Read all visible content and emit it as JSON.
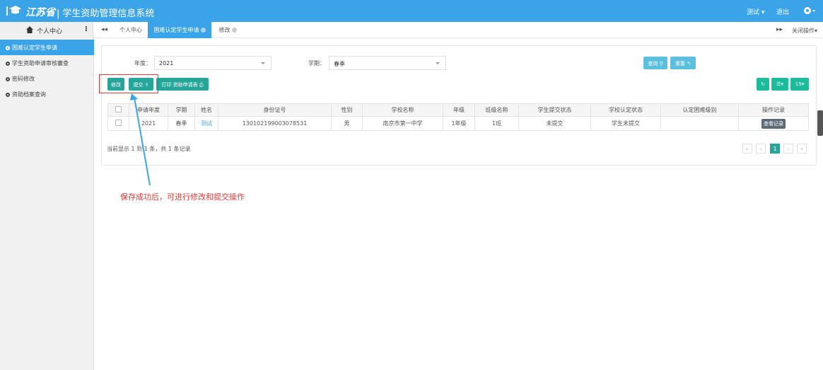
{
  "header": {
    "brand": "江苏省",
    "separator": "|",
    "system_name": "学生资助管理信息系统",
    "user_label": "测试 ▾",
    "logout_label": "退出"
  },
  "tabbar": {
    "side_title": "个人中心",
    "tabs": [
      {
        "label": "个人中心"
      },
      {
        "label": "困难认定学生申请"
      },
      {
        "label": "修改"
      }
    ],
    "close_ops_label": "关闭操作▾"
  },
  "sidebar": {
    "items": [
      {
        "label": "困难认定学生申请"
      },
      {
        "label": "学生资助申请审核審查"
      },
      {
        "label": "密码修改"
      },
      {
        "label": "资助档案查询"
      }
    ]
  },
  "filters": {
    "year_label": "年度：",
    "year_value": "2021",
    "term_label": "学期：",
    "term_value": "春季",
    "query_label": "查询",
    "reset_label": "重置"
  },
  "toolbar": {
    "edit_label": "修改",
    "submit_label": "提交",
    "print_label": "打印 资助申请表",
    "page_size": "15"
  },
  "table": {
    "headers": [
      "",
      "申请年度",
      "学期",
      "姓名",
      "身份证号",
      "性别",
      "学校名称",
      "年级",
      "班级名称",
      "学生提交状态",
      "学校认定状态",
      "认定困难级别",
      "操作记录"
    ],
    "rows": [
      [
        "",
        "2021",
        "春季",
        "测试",
        "13010219900307853​1",
        "男",
        "南京市第一中学",
        "1年级",
        "1班",
        "未提交",
        "学生未提交",
        "",
        "查看记录"
      ]
    ]
  },
  "pager": {
    "info": "当前显示 1 到 1 条，共 1 条记录",
    "current": "1"
  },
  "annotation": {
    "text": "保存成功后，可进行修改和提交操作",
    "color": "#e53935"
  },
  "colors": {
    "header_bg": "#3ba3e8",
    "primary_green": "#26a69a",
    "info_blue": "#5bc0de"
  }
}
